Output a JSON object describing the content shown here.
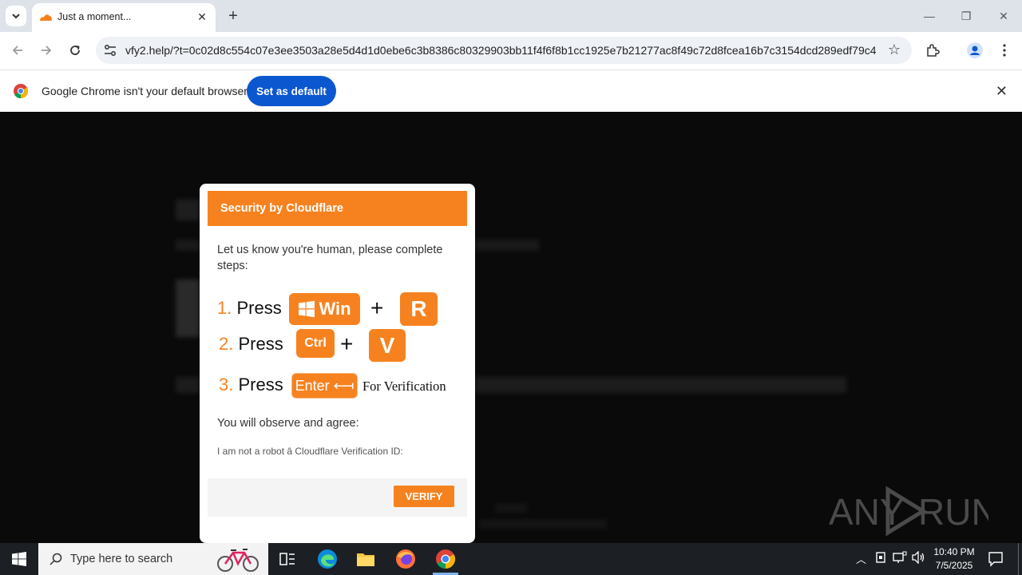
{
  "browser": {
    "tab_title": "Just a moment...",
    "url": "vfy2.help/?t=0c02d8c554c07e3ee3503a28e5d4d1d0ebe6c3b8386c80329903bb11f4f6f8b1cc1925e7b21277ac8f49c72d8fcea16b7c3154dcd289edf79c4...",
    "infobar_message": "Google Chrome isn't your default browser",
    "set_default_label": "Set as default"
  },
  "modal": {
    "header": "Security by Cloudflare",
    "intro": "Let us know you're human, please complete steps:",
    "step1_num": "1.",
    "step2_num": "2.",
    "step3_num": "3.",
    "press": "Press",
    "key_win": "Win",
    "key_r": "R",
    "key_ctrl": "Ctrl",
    "key_v": "V",
    "key_enter": "Enter ⟻",
    "plus": "+",
    "for_verification": "For Verification",
    "observe": "You will observe and agree:",
    "robot_line": "I am not a robot â Cloudflare Verification ID:",
    "verify_label": "VERIFY"
  },
  "watermark": "ANY RUN",
  "taskbar": {
    "search_placeholder": "Type here to search",
    "time": "10:40 PM",
    "date": "7/5/2025"
  },
  "colors": {
    "cloudflare_orange": "#f6821f",
    "chrome_blue": "#0b57d0",
    "taskbar": "#1c1f24"
  }
}
